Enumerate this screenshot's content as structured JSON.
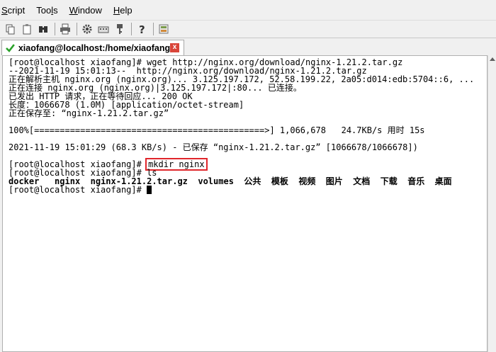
{
  "menu": {
    "items": [
      {
        "label": "Script"
      },
      {
        "label": "Tools"
      },
      {
        "label": "Window"
      },
      {
        "label": "Help"
      }
    ]
  },
  "toolbar": {
    "icons": [
      "copy-icon",
      "paste-icon",
      "find-icon",
      "print-icon",
      "settings-icon",
      "keymap-icon",
      "key-icon",
      "help-icon",
      "sftp-icon"
    ]
  },
  "tab": {
    "label": "xiaofang@localhost:/home/xiaofang",
    "close": "x",
    "status_color": "#2aa12a"
  },
  "terminal": {
    "lines": [
      "[root@localhost xiaofang]# wget http://nginx.org/download/nginx-1.21.2.tar.gz",
      "--2021-11-19 15:01:13--  http://nginx.org/download/nginx-1.21.2.tar.gz",
      "正在解析主机 nginx.org (nginx.org)... 3.125.197.172, 52.58.199.22, 2a05:d014:edb:5704::6, ...",
      "正在连接 nginx.org (nginx.org)|3.125.197.172|:80... 已连接。",
      "已发出 HTTP 请求，正在等待回应... 200 OK",
      "长度：1066678 (1.0M) [application/octet-stream]",
      "正在保存至: “nginx-1.21.2.tar.gz”",
      "",
      "100%[=============================================>] 1,066,678   24.7KB/s 用时 15s",
      "",
      "2021-11-19 15:01:29 (68.3 KB/s) - 已保存 “nginx-1.21.2.tar.gz” [1066678/1066678])",
      ""
    ],
    "prompt": "[root@localhost xiaofang]# ",
    "highlighted_command": "mkdir nginx",
    "ls_command": "ls",
    "ls_output": [
      "docker",
      "nginx",
      "nginx-1.21.2.tar.gz",
      "volumes",
      "公共",
      "模板",
      "视频",
      "图片",
      "文档",
      "下载",
      "音乐",
      "桌面"
    ],
    "highlight_color": "#e0262b"
  }
}
